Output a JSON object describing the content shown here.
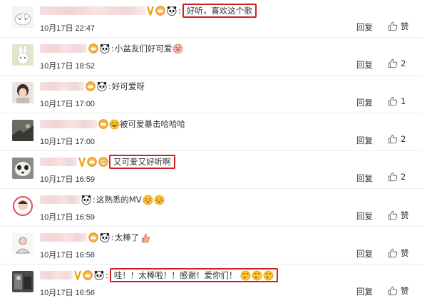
{
  "comments": [
    {
      "time": "10月17日 22:47",
      "text": "好听，喜欢这个歌",
      "framed": true,
      "reply_label": "回复",
      "like": "赞",
      "emojis": []
    },
    {
      "time": "10月17日 18:52",
      "text": "小盆友们好可爱",
      "framed": false,
      "reply_label": "回复",
      "like": "2",
      "emojis": [
        "pig-face-emoji"
      ]
    },
    {
      "time": "10月17日 17:00",
      "text": "好可爱呀",
      "framed": false,
      "reply_label": "回复",
      "like": "1",
      "emojis": []
    },
    {
      "time": "10月17日 17:00",
      "text": "被可爱暴击哈哈哈",
      "framed": false,
      "reply_label": "回复",
      "like": "2",
      "emojis": [
        "laughing-tears-emoji"
      ]
    },
    {
      "time": "10月17日 16:59",
      "text": "又可爱又好听啊",
      "framed": true,
      "reply_label": "回复",
      "like": "2",
      "emojis": []
    },
    {
      "time": "10月17日 16:59",
      "text": "这熟悉的MV",
      "framed": false,
      "reply_label": "回复",
      "like": "赞",
      "emojis": [
        "blushing-face-emoji",
        "blushing-face-emoji"
      ]
    },
    {
      "time": "10月17日 16:58",
      "text": "太棒了",
      "framed": false,
      "reply_label": "回复",
      "like": "赞",
      "emojis": [
        "thumbs-up-emoji"
      ]
    },
    {
      "time": "10月17日 16:56",
      "text": "哇！！太棒啦！！感谢！爱你们！",
      "framed": true,
      "reply_label": "回复",
      "like": "赞",
      "emojis": [
        "heart-kiss-emoji",
        "heart-kiss-emoji",
        "heart-kiss-emoji"
      ]
    }
  ],
  "colors": {
    "highlight_border": "#d0201f",
    "divider": "#ececec",
    "text": "#333333",
    "name_blur": "#f3d6d8"
  }
}
